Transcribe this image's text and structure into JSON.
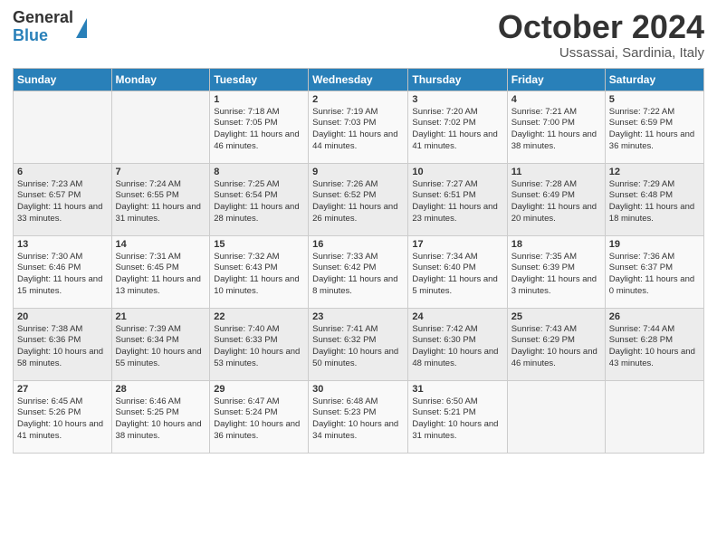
{
  "header": {
    "logo_general": "General",
    "logo_blue": "Blue",
    "month_title": "October 2024",
    "location": "Ussassai, Sardinia, Italy"
  },
  "days_of_week": [
    "Sunday",
    "Monday",
    "Tuesday",
    "Wednesday",
    "Thursday",
    "Friday",
    "Saturday"
  ],
  "weeks": [
    [
      {
        "day": "",
        "info": ""
      },
      {
        "day": "",
        "info": ""
      },
      {
        "day": "1",
        "info": "Sunrise: 7:18 AM\nSunset: 7:05 PM\nDaylight: 11 hours and 46 minutes."
      },
      {
        "day": "2",
        "info": "Sunrise: 7:19 AM\nSunset: 7:03 PM\nDaylight: 11 hours and 44 minutes."
      },
      {
        "day": "3",
        "info": "Sunrise: 7:20 AM\nSunset: 7:02 PM\nDaylight: 11 hours and 41 minutes."
      },
      {
        "day": "4",
        "info": "Sunrise: 7:21 AM\nSunset: 7:00 PM\nDaylight: 11 hours and 38 minutes."
      },
      {
        "day": "5",
        "info": "Sunrise: 7:22 AM\nSunset: 6:59 PM\nDaylight: 11 hours and 36 minutes."
      }
    ],
    [
      {
        "day": "6",
        "info": "Sunrise: 7:23 AM\nSunset: 6:57 PM\nDaylight: 11 hours and 33 minutes."
      },
      {
        "day": "7",
        "info": "Sunrise: 7:24 AM\nSunset: 6:55 PM\nDaylight: 11 hours and 31 minutes."
      },
      {
        "day": "8",
        "info": "Sunrise: 7:25 AM\nSunset: 6:54 PM\nDaylight: 11 hours and 28 minutes."
      },
      {
        "day": "9",
        "info": "Sunrise: 7:26 AM\nSunset: 6:52 PM\nDaylight: 11 hours and 26 minutes."
      },
      {
        "day": "10",
        "info": "Sunrise: 7:27 AM\nSunset: 6:51 PM\nDaylight: 11 hours and 23 minutes."
      },
      {
        "day": "11",
        "info": "Sunrise: 7:28 AM\nSunset: 6:49 PM\nDaylight: 11 hours and 20 minutes."
      },
      {
        "day": "12",
        "info": "Sunrise: 7:29 AM\nSunset: 6:48 PM\nDaylight: 11 hours and 18 minutes."
      }
    ],
    [
      {
        "day": "13",
        "info": "Sunrise: 7:30 AM\nSunset: 6:46 PM\nDaylight: 11 hours and 15 minutes."
      },
      {
        "day": "14",
        "info": "Sunrise: 7:31 AM\nSunset: 6:45 PM\nDaylight: 11 hours and 13 minutes."
      },
      {
        "day": "15",
        "info": "Sunrise: 7:32 AM\nSunset: 6:43 PM\nDaylight: 11 hours and 10 minutes."
      },
      {
        "day": "16",
        "info": "Sunrise: 7:33 AM\nSunset: 6:42 PM\nDaylight: 11 hours and 8 minutes."
      },
      {
        "day": "17",
        "info": "Sunrise: 7:34 AM\nSunset: 6:40 PM\nDaylight: 11 hours and 5 minutes."
      },
      {
        "day": "18",
        "info": "Sunrise: 7:35 AM\nSunset: 6:39 PM\nDaylight: 11 hours and 3 minutes."
      },
      {
        "day": "19",
        "info": "Sunrise: 7:36 AM\nSunset: 6:37 PM\nDaylight: 11 hours and 0 minutes."
      }
    ],
    [
      {
        "day": "20",
        "info": "Sunrise: 7:38 AM\nSunset: 6:36 PM\nDaylight: 10 hours and 58 minutes."
      },
      {
        "day": "21",
        "info": "Sunrise: 7:39 AM\nSunset: 6:34 PM\nDaylight: 10 hours and 55 minutes."
      },
      {
        "day": "22",
        "info": "Sunrise: 7:40 AM\nSunset: 6:33 PM\nDaylight: 10 hours and 53 minutes."
      },
      {
        "day": "23",
        "info": "Sunrise: 7:41 AM\nSunset: 6:32 PM\nDaylight: 10 hours and 50 minutes."
      },
      {
        "day": "24",
        "info": "Sunrise: 7:42 AM\nSunset: 6:30 PM\nDaylight: 10 hours and 48 minutes."
      },
      {
        "day": "25",
        "info": "Sunrise: 7:43 AM\nSunset: 6:29 PM\nDaylight: 10 hours and 46 minutes."
      },
      {
        "day": "26",
        "info": "Sunrise: 7:44 AM\nSunset: 6:28 PM\nDaylight: 10 hours and 43 minutes."
      }
    ],
    [
      {
        "day": "27",
        "info": "Sunrise: 6:45 AM\nSunset: 5:26 PM\nDaylight: 10 hours and 41 minutes."
      },
      {
        "day": "28",
        "info": "Sunrise: 6:46 AM\nSunset: 5:25 PM\nDaylight: 10 hours and 38 minutes."
      },
      {
        "day": "29",
        "info": "Sunrise: 6:47 AM\nSunset: 5:24 PM\nDaylight: 10 hours and 36 minutes."
      },
      {
        "day": "30",
        "info": "Sunrise: 6:48 AM\nSunset: 5:23 PM\nDaylight: 10 hours and 34 minutes."
      },
      {
        "day": "31",
        "info": "Sunrise: 6:50 AM\nSunset: 5:21 PM\nDaylight: 10 hours and 31 minutes."
      },
      {
        "day": "",
        "info": ""
      },
      {
        "day": "",
        "info": ""
      }
    ]
  ]
}
